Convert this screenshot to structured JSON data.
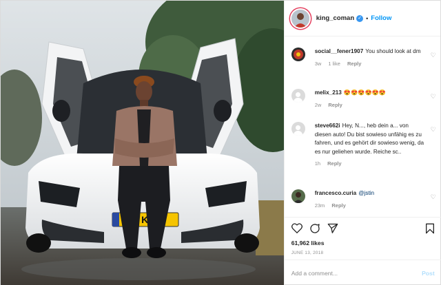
{
  "post": {
    "account": {
      "username": "king_coman",
      "verified_icon": "verified-badge-icon",
      "separator": "•",
      "follow_label": "Follow"
    },
    "photo": {
      "plate_text": "K  6",
      "subject": "man in leather jacket sitting on white supercar with open doors"
    },
    "comments": [
      {
        "username": "social__fener1907",
        "text": "You should look at dm",
        "time": "3w",
        "likes": "1 like",
        "reply": "Reply",
        "avatar": "red-badge"
      },
      {
        "username": "melix_213",
        "text": "😍😍😍😍😍😍",
        "time": "2w",
        "likes": "",
        "reply": "Reply",
        "avatar": "default"
      },
      {
        "username": "steve662i",
        "text": "Hey, N..., heb dein a... von diesen auto! Du bist sowieso unfähig es zu fahren, und es gehört dir sowieso wenig, da es nur geliehen wurde. Reiche sc..",
        "time": "1h",
        "likes": "",
        "reply": "Reply",
        "avatar": "default"
      },
      {
        "username": "francesco.curia",
        "text": "@jstin",
        "time": "23m",
        "likes": "",
        "reply": "Reply",
        "avatar": "photo"
      }
    ],
    "actions": {
      "like_icon": "heart-icon",
      "comment_icon": "comment-icon",
      "share_icon": "paper-plane-icon",
      "save_icon": "bookmark-icon"
    },
    "likes": "61,962 likes",
    "date": "JUNE 13, 2018",
    "add_comment": {
      "placeholder": "Add a comment...",
      "post_label": "Post"
    },
    "colors": {
      "accent": "#0095f6",
      "verified": "#3897f0",
      "muted": "#8e8e8e",
      "post_disabled": "#b2dffc"
    }
  }
}
